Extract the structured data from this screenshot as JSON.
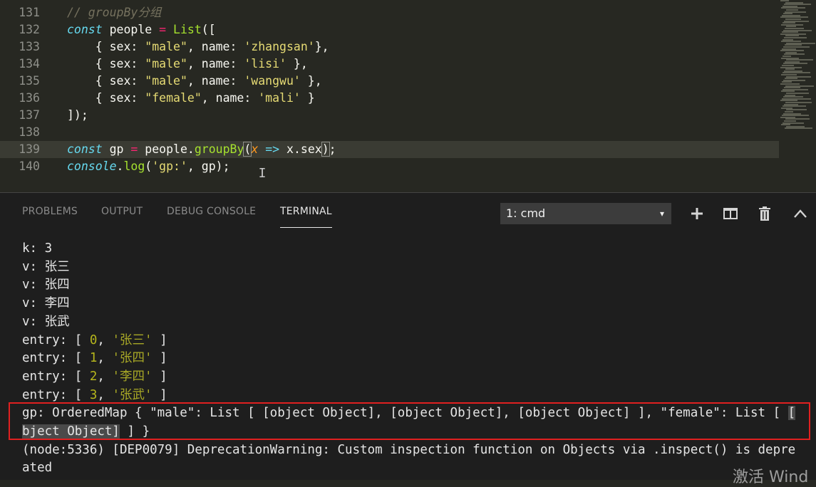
{
  "editor": {
    "lines": [
      {
        "num": "131",
        "tokens": [
          {
            "c": "t-com",
            "t": "// groupBy分组"
          }
        ]
      },
      {
        "num": "132",
        "tokens": [
          {
            "c": "t-kw",
            "t": "const"
          },
          {
            "c": "t-var",
            "t": " people "
          },
          {
            "c": "t-op",
            "t": "="
          },
          {
            "c": "t-var",
            "t": " "
          },
          {
            "c": "t-fn",
            "t": "List"
          },
          {
            "c": "t-punc",
            "t": "(["
          }
        ]
      },
      {
        "num": "133",
        "tokens": [
          {
            "c": "t-punc",
            "t": "    { sex: "
          },
          {
            "c": "t-str",
            "t": "\"male\""
          },
          {
            "c": "t-punc",
            "t": ", name: "
          },
          {
            "c": "t-str",
            "t": "'zhangsan'"
          },
          {
            "c": "t-punc",
            "t": "},"
          }
        ]
      },
      {
        "num": "134",
        "tokens": [
          {
            "c": "t-punc",
            "t": "    { sex: "
          },
          {
            "c": "t-str",
            "t": "\"male\""
          },
          {
            "c": "t-punc",
            "t": ", name: "
          },
          {
            "c": "t-str",
            "t": "'lisi'"
          },
          {
            "c": "t-punc",
            "t": " },"
          }
        ]
      },
      {
        "num": "135",
        "tokens": [
          {
            "c": "t-punc",
            "t": "    { sex: "
          },
          {
            "c": "t-str",
            "t": "\"male\""
          },
          {
            "c": "t-punc",
            "t": ", name: "
          },
          {
            "c": "t-str",
            "t": "'wangwu'"
          },
          {
            "c": "t-punc",
            "t": " },"
          }
        ]
      },
      {
        "num": "136",
        "tokens": [
          {
            "c": "t-punc",
            "t": "    { sex: "
          },
          {
            "c": "t-str",
            "t": "\"female\""
          },
          {
            "c": "t-punc",
            "t": ", name: "
          },
          {
            "c": "t-str",
            "t": "'mali'"
          },
          {
            "c": "t-punc",
            "t": " }"
          }
        ]
      },
      {
        "num": "137",
        "tokens": [
          {
            "c": "t-punc",
            "t": "]);"
          }
        ]
      },
      {
        "num": "138",
        "tokens": []
      },
      {
        "num": "139",
        "current": true,
        "tokens": [
          {
            "c": "t-kw",
            "t": "const"
          },
          {
            "c": "t-var",
            "t": " gp "
          },
          {
            "c": "t-op",
            "t": "="
          },
          {
            "c": "t-var",
            "t": " people."
          },
          {
            "c": "t-fn",
            "t": "groupBy"
          },
          {
            "c": "t-punc bracket-hl",
            "t": "("
          },
          {
            "c": "t-param",
            "t": "x"
          },
          {
            "c": "t-var",
            "t": " "
          },
          {
            "c": "t-kw",
            "t": "=>"
          },
          {
            "c": "t-var",
            "t": " x.sex"
          },
          {
            "c": "t-punc bracket-hl",
            "t": ")"
          },
          {
            "c": "t-punc",
            "t": ";"
          }
        ]
      },
      {
        "num": "140",
        "tokens": [
          {
            "c": "t-kw",
            "t": "console"
          },
          {
            "c": "t-punc",
            "t": "."
          },
          {
            "c": "t-fn",
            "t": "log"
          },
          {
            "c": "t-punc",
            "t": "("
          },
          {
            "c": "t-str",
            "t": "'gp:'"
          },
          {
            "c": "t-punc",
            "t": ", gp);"
          }
        ]
      }
    ],
    "cursor_glyph": "I"
  },
  "panel": {
    "tabs": [
      "PROBLEMS",
      "OUTPUT",
      "DEBUG CONSOLE",
      "TERMINAL"
    ],
    "active_tab": "TERMINAL",
    "terminal_select": "1: cmd",
    "dropdown_glyph": "▾",
    "icons": [
      {
        "name": "plus-icon",
        "glyph": "+"
      },
      {
        "name": "split-icon",
        "glyph": "◫"
      },
      {
        "name": "trash-icon",
        "glyph": "🗑"
      },
      {
        "name": "chevron-up-icon",
        "glyph": "^"
      }
    ]
  },
  "terminal": {
    "lines": [
      {
        "segs": [
          {
            "t": "k: 3"
          }
        ]
      },
      {
        "segs": [
          {
            "t": "v: 张三"
          }
        ]
      },
      {
        "segs": [
          {
            "t": "v: 张四"
          }
        ]
      },
      {
        "segs": [
          {
            "t": "v: 李四"
          }
        ]
      },
      {
        "segs": [
          {
            "t": "v: 张武"
          }
        ]
      },
      {
        "segs": [
          {
            "t": "entry: [ "
          },
          {
            "c": "y",
            "t": "0"
          },
          {
            "t": ", "
          },
          {
            "c": "g",
            "t": "'张三'"
          },
          {
            "t": " ]"
          }
        ]
      },
      {
        "segs": [
          {
            "t": "entry: [ "
          },
          {
            "c": "y",
            "t": "1"
          },
          {
            "t": ", "
          },
          {
            "c": "g",
            "t": "'张四'"
          },
          {
            "t": " ]"
          }
        ]
      },
      {
        "segs": [
          {
            "t": "entry: [ "
          },
          {
            "c": "y",
            "t": "2"
          },
          {
            "t": ", "
          },
          {
            "c": "g",
            "t": "'李四'"
          },
          {
            "t": " ]"
          }
        ]
      },
      {
        "segs": [
          {
            "t": "entry: [ "
          },
          {
            "c": "y",
            "t": "3"
          },
          {
            "t": ", "
          },
          {
            "c": "g",
            "t": "'张武'"
          },
          {
            "t": " ]"
          }
        ]
      },
      {
        "segs": [
          {
            "t": "gp: OrderedMap { \"male\": List [ [object Object], [object Object], [object Object] ], \"female\": List [ "
          },
          {
            "c": "hl-sel",
            "t": "["
          }
        ]
      },
      {
        "segs": [
          {
            "c": "hl-sel",
            "t": "bject Object]"
          },
          {
            "t": " ] }"
          }
        ]
      },
      {
        "segs": [
          {
            "t": "(node:5336) [DEP0079] DeprecationWarning: Custom inspection function on Objects via .inspect() is depre"
          }
        ]
      },
      {
        "segs": [
          {
            "t": "ated"
          }
        ]
      }
    ]
  },
  "watermark": "激活 Wind"
}
